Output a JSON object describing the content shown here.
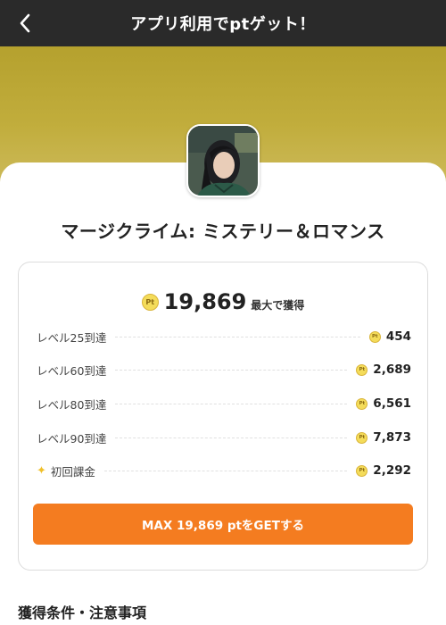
{
  "header": {
    "title": "アプリ利用でptゲット！"
  },
  "app": {
    "name": "マージクライム: ミステリー＆ロマンス"
  },
  "summary": {
    "coin_label": "Pt",
    "total": "19,869",
    "suffix": "最大で獲得"
  },
  "rewards": [
    {
      "label": "レベル25到達",
      "value": "454"
    },
    {
      "label": "レベル60到達",
      "value": "2,689"
    },
    {
      "label": "レベル80到達",
      "value": "6,561"
    },
    {
      "label": "レベル90到達",
      "value": "7,873"
    },
    {
      "label": "初回課金",
      "value": "2,292",
      "icon": "sparkle-icon"
    }
  ],
  "cta": {
    "label": "MAX 19,869 ptをGETする"
  },
  "notes": {
    "title": "獲得条件・注意事項"
  },
  "colors": {
    "header_bg": "#2a2a2a",
    "hero_gold": "#b5a12e",
    "accent_orange": "#f47c20",
    "coin_yellow": "#f4dc5a"
  }
}
